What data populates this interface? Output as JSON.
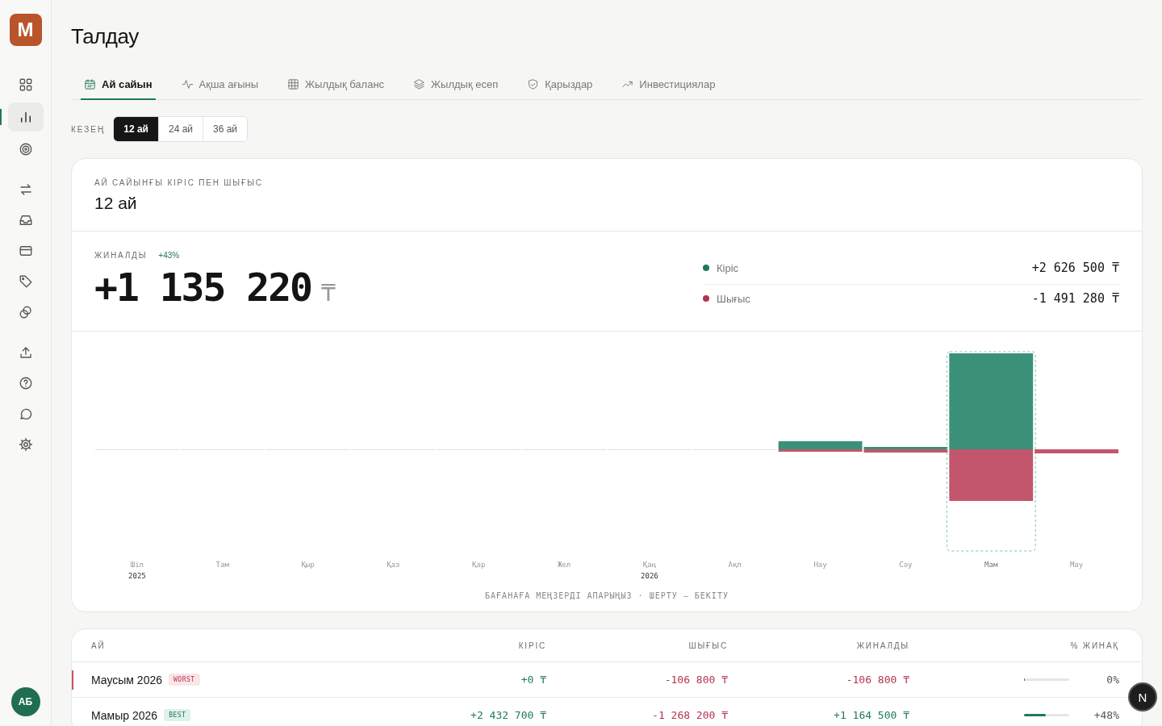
{
  "brand": {
    "logo": "M"
  },
  "sidebar": {
    "groups": [
      [
        {
          "selected": false
        },
        {
          "selected": true
        },
        {
          "selected": false
        }
      ],
      [
        {
          "selected": false
        },
        {
          "selected": false
        },
        {
          "selected": false
        },
        {
          "selected": false
        },
        {
          "selected": false
        }
      ],
      [
        {
          "selected": false
        },
        {
          "selected": false
        },
        {
          "selected": false
        },
        {
          "selected": false
        }
      ]
    ],
    "user": {
      "initials": "АБ"
    }
  },
  "page": {
    "title": "Талдау"
  },
  "tabs": [
    {
      "label": "Ай сайын",
      "selected": true
    },
    {
      "label": "Ақша ағыны",
      "selected": false
    },
    {
      "label": "Жылдық баланс",
      "selected": false
    },
    {
      "label": "Жылдық есеп",
      "selected": false
    },
    {
      "label": "Қарыздар",
      "selected": false
    },
    {
      "label": "Инвестициялар",
      "selected": false
    }
  ],
  "period": {
    "label": "КЕЗЕҢ",
    "options": [
      {
        "label": "12 ай",
        "selected": true
      },
      {
        "label": "24 ай",
        "selected": false
      },
      {
        "label": "36 ай",
        "selected": false
      }
    ]
  },
  "summary_card": {
    "eyebrow": "АЙ САЙЫНҒЫ КІРІС ПЕН ШЫҒЫС",
    "title": "12 ай",
    "savings": {
      "label": "ЖИНАЛДЫ",
      "change": "+43%",
      "amount": "+1 135 220",
      "currency": "₸"
    },
    "legend": [
      {
        "label": "Кіріс",
        "value": "+2 626 500",
        "currency": "₸",
        "color": "#1f7a5a"
      },
      {
        "label": "Шығыс",
        "value": "-1 491 280",
        "currency": "₸",
        "color": "#b5334f"
      }
    ],
    "chart": {
      "months": [
        {
          "label": "Шіл",
          "year": "2025",
          "selected": false
        },
        {
          "label": "Там",
          "selected": false
        },
        {
          "label": "Қыр",
          "selected": false
        },
        {
          "label": "Қаз",
          "selected": false
        },
        {
          "label": "Қар",
          "selected": false
        },
        {
          "label": "Жел",
          "selected": false
        },
        {
          "label": "Қаң",
          "year": "2026",
          "selected": false
        },
        {
          "label": "Ақп",
          "selected": false
        },
        {
          "label": "Нау",
          "selected": false
        },
        {
          "label": "Сәу",
          "selected": false
        },
        {
          "label": "Мам",
          "selected": true
        },
        {
          "label": "Мау",
          "selected": false
        }
      ],
      "hint": "БАҒАНАҒА МЕҢЗЕРДІ АПАРЫҢЫЗ · ШЕРТУ — БЕКІТУ"
    }
  },
  "table": {
    "columns": [
      "АЙ",
      "КІРІС",
      "ШЫҒЫС",
      "ЖИНАЛДЫ",
      "% ЖИНАҚ"
    ],
    "rows": [
      {
        "month": "Маусым 2026",
        "badge": {
          "kind": "worst",
          "text": "WORST"
        },
        "income": "+0",
        "expense": "-106 800",
        "saved": {
          "text": "-106 800",
          "color": "#b5334f"
        },
        "currency": "₸",
        "level": 0,
        "rate": "0%"
      },
      {
        "month": "Мамыр 2026",
        "badge": {
          "kind": "best",
          "text": "BEST"
        },
        "income": "+2 432 700",
        "expense": "-1 268 200",
        "saved": {
          "text": "+1 164 500",
          "color": "#1f7a5a"
        },
        "currency": "₸",
        "level": 0.48,
        "rate": "+48%"
      }
    ]
  },
  "dev_badge": {
    "text": "N"
  }
}
